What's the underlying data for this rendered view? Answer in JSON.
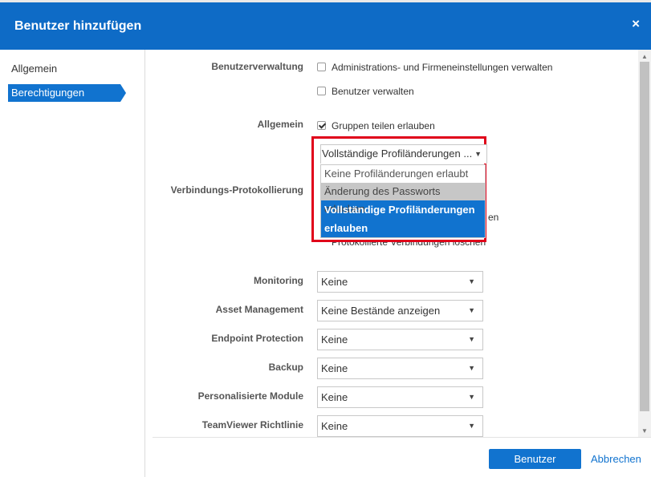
{
  "dialog": {
    "title": "Benutzer hinzufügen",
    "close": "×"
  },
  "sidebar": {
    "items": [
      {
        "label": "Allgemein"
      },
      {
        "label": "Berechtigungen",
        "active": true
      }
    ]
  },
  "sections": {
    "benutzerverwaltung": {
      "label": "Benutzerverwaltung",
      "options": [
        {
          "label": "Administrations- und Firmeneinstellungen verwalten",
          "checked": false
        },
        {
          "label": "Benutzer verwalten",
          "checked": false
        }
      ]
    },
    "allgemein": {
      "label": "Allgemein",
      "options": [
        {
          "label": "Gruppen teilen erlauben",
          "checked": true
        }
      ],
      "profile_select": {
        "value": "Vollständige Profiländerungen ...",
        "options": [
          "Keine Profiländerungen erlaubt",
          "Änderung des Passworts erlauben",
          "Vollständige Profiländerungen erlauben"
        ],
        "hovered_index": 1,
        "selected_index": 2
      }
    },
    "verbindungs_protokollierung": {
      "label": "Verbindungs-Protokollierung",
      "partial_text_1": "en",
      "partial_text_2": "Protokollierte Verbindungen löschen"
    }
  },
  "selects": [
    {
      "label": "Monitoring",
      "value": "Keine"
    },
    {
      "label": "Asset Management",
      "value": "Keine Bestände anzeigen"
    },
    {
      "label": "Endpoint Protection",
      "value": "Keine"
    },
    {
      "label": "Backup",
      "value": "Keine"
    },
    {
      "label": "Personalisierte Module",
      "value": "Keine"
    },
    {
      "label": "TeamViewer Richtlinie",
      "value": "Keine"
    }
  ],
  "footer": {
    "add_button": "Benutzer hinzufügen",
    "cancel_link": "Abbrechen"
  },
  "colors": {
    "accent": "#1173cf",
    "header": "#0e6bc6",
    "highlight_outline": "#e0001a"
  }
}
